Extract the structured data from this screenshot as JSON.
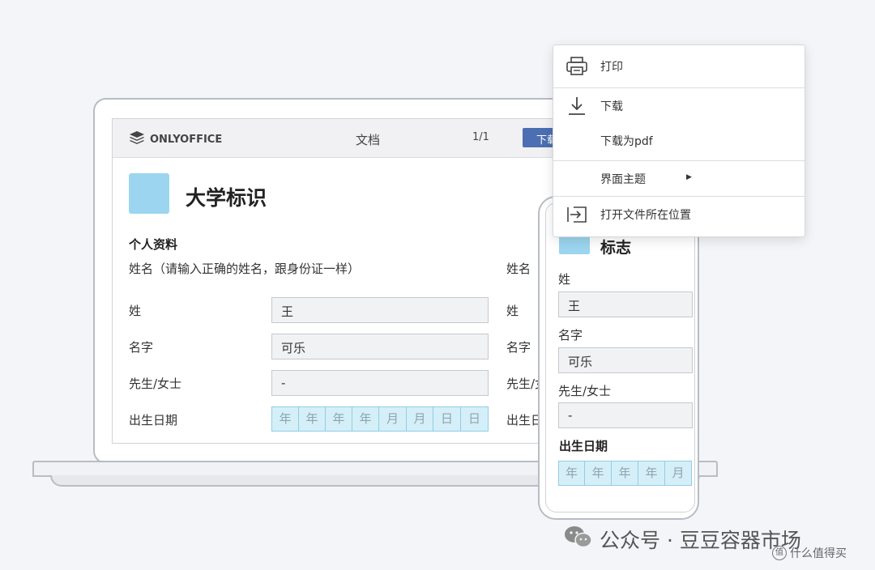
{
  "app": {
    "logo_text": "ONLYOFFICE",
    "doc_title": "文档",
    "page_count": "1/1",
    "download_button": "下载"
  },
  "form": {
    "title": "大学标识",
    "section_title": "个人资料",
    "name_hint": "姓名（请输入正确的姓名，跟身份证一样）",
    "right_name_label": "姓名",
    "fields": {
      "surname": {
        "label": "姓",
        "value": "王"
      },
      "given_name": {
        "label": "名字",
        "value": "可乐"
      },
      "title": {
        "label": "先生/女士",
        "value": "-"
      },
      "birthdate": {
        "label": "出生日期",
        "cells": [
          "年",
          "年",
          "年",
          "年",
          "月",
          "月",
          "日",
          "日"
        ]
      }
    },
    "right_labels": [
      "姓",
      "名字",
      "先生/女士",
      "出生日"
    ]
  },
  "phone": {
    "title": "标志",
    "surname_label": "姓",
    "surname_value": "王",
    "given_name_label": "名字",
    "given_name_value": "可乐",
    "title_label": "先生/女士",
    "title_value": "-",
    "birthdate_label": "出生日期",
    "birthdate_cells": [
      "年",
      "年",
      "年",
      "年",
      "月"
    ]
  },
  "menu": {
    "items": [
      {
        "label": "打印",
        "icon": "printer-icon"
      },
      {
        "label": "下载",
        "icon": "download-icon"
      },
      {
        "label": "下载为pdf",
        "icon": ""
      },
      {
        "label": "界面主题",
        "icon": "",
        "submenu": true
      },
      {
        "label": "打开文件所在位置",
        "icon": "open-location-icon"
      }
    ]
  },
  "watermark": {
    "text": "公众号 · 豆豆容器市场",
    "site": "什么值得买",
    "site_badge": "值"
  },
  "colors": {
    "brand_square": "#9bd5ef",
    "download_button": "#4b6fb2",
    "date_cell": "#d5eff8",
    "field_bg": "#f1f2f4"
  }
}
